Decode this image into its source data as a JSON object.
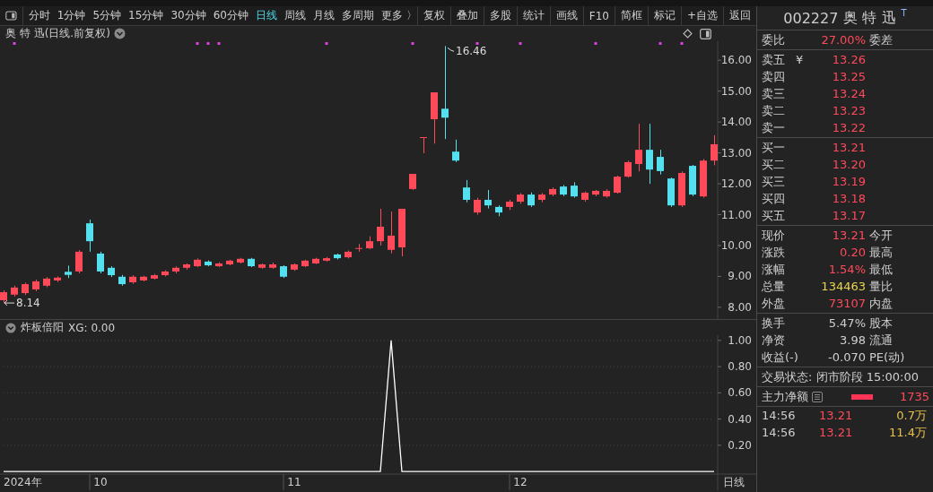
{
  "toolbar": {
    "periods": [
      {
        "label": "分时",
        "selected": false
      },
      {
        "label": "1分钟",
        "selected": false
      },
      {
        "label": "5分钟",
        "selected": false
      },
      {
        "label": "15分钟",
        "selected": false
      },
      {
        "label": "30分钟",
        "selected": false
      },
      {
        "label": "60分钟",
        "selected": false
      },
      {
        "label": "日线",
        "selected": true
      },
      {
        "label": "周线",
        "selected": false
      },
      {
        "label": "月线",
        "selected": false
      },
      {
        "label": "多周期",
        "selected": false
      },
      {
        "label": "更多 〉",
        "selected": false
      }
    ],
    "buttons": [
      "复权",
      "叠加",
      "多股",
      "统计",
      "画线",
      "F10",
      "简框",
      "标记",
      "+自选",
      "返回"
    ]
  },
  "chart_title": "奥 特 迅(日线.前复权)",
  "price_chart": {
    "chart_data": {
      "type": "candlestick",
      "ylim": [
        7.62,
        16.47
      ],
      "yticks": [
        {
          "value": 8,
          "label": "8.00"
        },
        {
          "value": 9,
          "label": "9.00"
        },
        {
          "value": 10,
          "label": "10.00"
        },
        {
          "value": 11,
          "label": "11.00"
        },
        {
          "value": 12,
          "label": "12.00"
        },
        {
          "value": 13,
          "label": "13.00"
        },
        {
          "value": 14,
          "label": "14.00"
        },
        {
          "value": 15,
          "label": "15.00"
        },
        {
          "value": 16,
          "label": "16.00"
        }
      ],
      "categories": [
        null,
        null,
        null,
        null,
        null,
        null,
        null,
        null,
        null,
        null,
        null,
        null,
        null,
        null,
        null,
        null,
        null,
        null,
        null,
        null,
        null,
        null,
        null,
        null,
        null,
        null,
        null,
        null,
        null,
        null,
        null,
        null,
        null,
        null,
        null,
        null,
        null,
        null,
        null,
        null,
        null,
        null,
        null,
        null,
        null,
        null,
        null,
        null,
        null,
        null,
        null,
        null,
        null,
        null,
        null,
        null,
        null,
        null,
        null,
        null,
        null,
        null,
        null,
        null,
        null,
        null,
        null
      ],
      "ohlc": [
        [
          8.23,
          8.55,
          8.14,
          8.49
        ],
        [
          8.41,
          8.7,
          8.35,
          8.64
        ],
        [
          8.46,
          8.8,
          8.4,
          8.75
        ],
        [
          8.58,
          8.9,
          8.52,
          8.84
        ],
        [
          8.7,
          8.98,
          8.65,
          8.93
        ],
        [
          8.87,
          9.0,
          8.82,
          8.96
        ],
        [
          9.15,
          9.35,
          8.95,
          9.05
        ],
        [
          9.16,
          9.85,
          9.1,
          9.8
        ],
        [
          10.72,
          10.84,
          9.8,
          10.14
        ],
        [
          9.74,
          9.8,
          9.1,
          9.16
        ],
        [
          9.28,
          9.33,
          8.98,
          9.04
        ],
        [
          8.99,
          9.05,
          8.7,
          8.75
        ],
        [
          8.81,
          9.04,
          8.76,
          8.99
        ],
        [
          8.87,
          9.02,
          8.84,
          8.99
        ],
        [
          8.93,
          9.08,
          8.9,
          9.04
        ],
        [
          9.04,
          9.2,
          9.0,
          9.16
        ],
        [
          9.16,
          9.32,
          9.1,
          9.28
        ],
        [
          9.28,
          9.42,
          9.22,
          9.39
        ],
        [
          9.33,
          9.58,
          9.3,
          9.54
        ],
        [
          9.48,
          9.52,
          9.33,
          9.36
        ],
        [
          9.33,
          9.46,
          9.3,
          9.42
        ],
        [
          9.39,
          9.54,
          9.36,
          9.51
        ],
        [
          9.45,
          9.6,
          9.42,
          9.57
        ],
        [
          9.57,
          9.6,
          9.3,
          9.33
        ],
        [
          9.28,
          9.42,
          9.25,
          9.39
        ],
        [
          9.28,
          9.45,
          9.25,
          9.39
        ],
        [
          9.33,
          9.36,
          8.95,
          8.99
        ],
        [
          9.22,
          9.42,
          9.18,
          9.39
        ],
        [
          9.33,
          9.54,
          9.3,
          9.51
        ],
        [
          9.42,
          9.6,
          9.4,
          9.57
        ],
        [
          9.51,
          9.63,
          9.48,
          9.59
        ],
        [
          9.71,
          9.74,
          9.55,
          9.59
        ],
        [
          9.62,
          9.84,
          9.58,
          9.8
        ],
        [
          9.9,
          10.05,
          9.8,
          9.92
        ],
        [
          9.91,
          10.3,
          9.88,
          10.14
        ],
        [
          10.14,
          11.19,
          10.0,
          10.61
        ],
        [
          9.86,
          11.1,
          9.75,
          10.32
        ],
        [
          9.94,
          11.19,
          9.65,
          11.19
        ],
        [
          11.83,
          12.32,
          11.8,
          12.32
        ],
        [
          13.51,
          13.51,
          12.99,
          13.51
        ],
        [
          14.09,
          14.96,
          13.3,
          14.96
        ],
        [
          14.43,
          16.46,
          13.45,
          14.14
        ],
        [
          13.04,
          13.43,
          12.7,
          12.75
        ],
        [
          11.88,
          12.12,
          11.4,
          11.48
        ],
        [
          11.07,
          11.55,
          11.0,
          11.48
        ],
        [
          11.48,
          11.8,
          11.2,
          11.3
        ],
        [
          11.25,
          11.3,
          10.95,
          11.07
        ],
        [
          11.25,
          11.48,
          11.15,
          11.42
        ],
        [
          11.42,
          11.7,
          11.35,
          11.65
        ],
        [
          11.65,
          11.72,
          11.25,
          11.3
        ],
        [
          11.48,
          11.7,
          11.4,
          11.65
        ],
        [
          11.65,
          11.88,
          11.6,
          11.83
        ],
        [
          11.91,
          11.96,
          11.6,
          11.65
        ],
        [
          11.94,
          12.05,
          11.55,
          11.59
        ],
        [
          11.48,
          11.75,
          11.42,
          11.71
        ],
        [
          11.65,
          11.8,
          11.6,
          11.77
        ],
        [
          11.59,
          11.82,
          11.55,
          11.77
        ],
        [
          11.71,
          12.26,
          11.68,
          12.23
        ],
        [
          12.23,
          12.75,
          12.2,
          12.7
        ],
        [
          12.64,
          13.94,
          12.4,
          13.1
        ],
        [
          13.1,
          13.94,
          12.0,
          12.46
        ],
        [
          12.87,
          13.1,
          12.3,
          12.41
        ],
        [
          12.17,
          12.2,
          11.25,
          11.3
        ],
        [
          11.3,
          12.4,
          11.25,
          12.35
        ],
        [
          12.58,
          12.61,
          11.6,
          11.65
        ],
        [
          11.59,
          12.8,
          11.55,
          12.75
        ],
        [
          12.75,
          13.57,
          12.6,
          13.28
        ]
      ],
      "annotations": [
        {
          "text": "16.46"
        },
        {
          "text": "8.14"
        }
      ]
    }
  },
  "indicator": {
    "title": "炸板倍阳",
    "reading": "XG: 0.00",
    "year_label": "2024年",
    "period_label": "日线",
    "chart_data": {
      "type": "line",
      "ylim": [
        -0.02,
        1.04
      ],
      "grid": true,
      "yticks": [
        {
          "value": 0.2,
          "label": "0.20"
        },
        {
          "value": 0.4,
          "label": "0.40"
        },
        {
          "value": 0.6,
          "label": "0.60"
        },
        {
          "value": 0.8,
          "label": "0.80"
        },
        {
          "value": 1,
          "label": "1.00"
        }
      ],
      "categories": [
        null,
        null,
        null,
        null,
        null,
        null,
        null,
        null,
        null,
        "10",
        null,
        null,
        null,
        null,
        null,
        null,
        null,
        null,
        null,
        null,
        null,
        null,
        null,
        null,
        null,
        null,
        null,
        "11",
        null,
        null,
        null,
        null,
        null,
        null,
        null,
        null,
        null,
        null,
        null,
        null,
        null,
        null,
        null,
        null,
        null,
        null,
        null,
        null,
        "12",
        null,
        null,
        null,
        null,
        null,
        null,
        null,
        null,
        null,
        null,
        null,
        null,
        null,
        null,
        null,
        null,
        null,
        null
      ],
      "series": [
        {
          "color": "#ffffff",
          "values": [
            0,
            0,
            0,
            0,
            0,
            0,
            0,
            0,
            0,
            0,
            0,
            0,
            0,
            0,
            0,
            0,
            0,
            0,
            0,
            0,
            0,
            0,
            0,
            0,
            0,
            0,
            0,
            0,
            0,
            0,
            0,
            0,
            0,
            0,
            0,
            0,
            1,
            0,
            0,
            0,
            0,
            0,
            0,
            0,
            0,
            0,
            0,
            0,
            0,
            0,
            0,
            0,
            0,
            0,
            0,
            0,
            0,
            0,
            0,
            0,
            0,
            0,
            0,
            0,
            0,
            0,
            0
          ]
        }
      ]
    }
  },
  "quote": {
    "code": "002227",
    "name": "奥 特 迅",
    "badge": "T",
    "ratio": {
      "label": "委比",
      "value": "27.00%",
      "label2": "委差"
    },
    "asks": [
      {
        "label": "卖五",
        "marker": "¥",
        "price": "13.26"
      },
      {
        "label": "卖四",
        "price": "13.25"
      },
      {
        "label": "卖三",
        "price": "13.24"
      },
      {
        "label": "卖二",
        "price": "13.23"
      },
      {
        "label": "卖一",
        "price": "13.22"
      }
    ],
    "bids": [
      {
        "label": "买一",
        "price": "13.21"
      },
      {
        "label": "买二",
        "price": "13.20"
      },
      {
        "label": "买三",
        "price": "13.19"
      },
      {
        "label": "买四",
        "price": "13.18"
      },
      {
        "label": "买五",
        "price": "13.17"
      }
    ],
    "stats": [
      {
        "label": "现价",
        "value": "13.21",
        "label2": "今开",
        "color": "#ff4a5a"
      },
      {
        "label": "涨跌",
        "value": "0.20",
        "label2": "最高",
        "color": "#ff4a5a"
      },
      {
        "label": "涨幅",
        "value": "1.54%",
        "label2": "最低",
        "color": "#ff4a5a"
      },
      {
        "label": "总量",
        "value": "134463",
        "label2": "量比",
        "color": "#e8d44d"
      },
      {
        "label": "外盘",
        "value": "73107",
        "label2": "内盘",
        "color": "#ff4a5a"
      }
    ],
    "stats2": [
      {
        "label": "换手",
        "value": "5.47%",
        "label2": "股本"
      },
      {
        "label": "净资",
        "value": "3.98",
        "label2": "流通"
      },
      {
        "label": "收益(-)",
        "value": "-0.070",
        "label2": "PE(动)"
      }
    ],
    "status": "交易状态: 闭市阶段 15:00:00",
    "main_flow": {
      "label": "主力净额",
      "value": "1735"
    },
    "trades": [
      {
        "time": "14:56",
        "price": "13.21",
        "volume": "0.7万"
      },
      {
        "time": "14:56",
        "price": "13.21",
        "volume": "11.4万"
      }
    ]
  }
}
